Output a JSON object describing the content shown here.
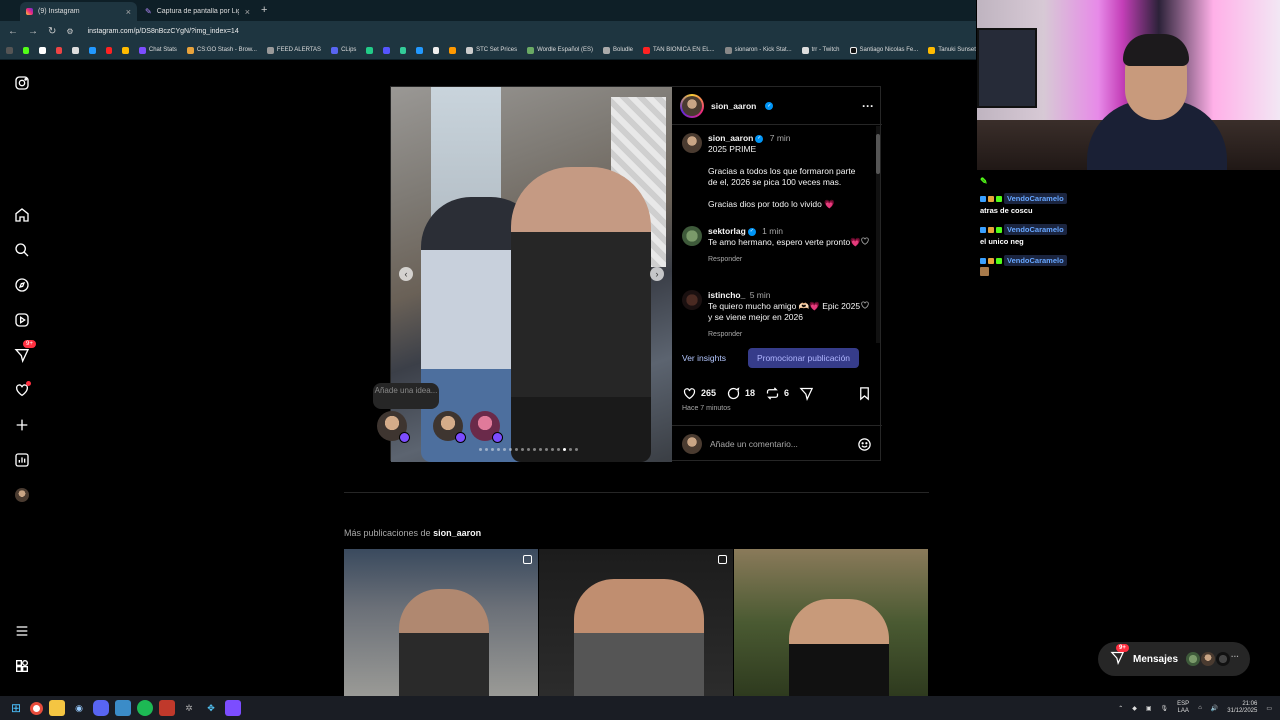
{
  "browser": {
    "tabs": [
      {
        "title": "(9) Instagram",
        "active": true
      },
      {
        "title": "Captura de pantalla por Lightsh",
        "active": false
      }
    ],
    "url": "instagram.com/p/DS8nBczCYgN/?img_index=14",
    "bookmarks": [
      "Chat Stats",
      "CS:GO Stash - Brow...",
      "FEED ALERTAS",
      "CLips",
      "STC Set Prices",
      "Wordle Español (ES)",
      "Boludle",
      "TAN BIONICA EN EL...",
      "sionaron - Kick Stat...",
      "trr - Twitch",
      "Santiago Nicolas Fe...",
      "Tanuki Sunset"
    ]
  },
  "post": {
    "author": "sion_aaron",
    "comments": [
      {
        "user": "sion_aaron",
        "time": "7 min",
        "lines": [
          "2025 PRIME",
          "Gracias a todos los que formaron parte de el, 2026 se pica 100 veces mas.",
          "Gracias dios por todo lo vivido 💗"
        ]
      },
      {
        "user": "sektorlag",
        "time": "1 min",
        "text": "Te amo hermano, espero verte pronto💗",
        "reply": "Responder"
      },
      {
        "user": "istincho_",
        "time": "5 min",
        "text": "Te quiero mucho amigo 🫶🏻💗 Epic 2025 y se viene mejor en 2026",
        "reply": "Responder"
      }
    ],
    "insights_label": "Ver insights",
    "promote_label": "Promocionar publicación",
    "likes": "265",
    "comment_count": "18",
    "reposts": "6",
    "posted_ago": "Hace 7 minutos",
    "add_comment_placeholder": "Añade un comentario...",
    "carousel_active_index": 14
  },
  "idea_bubble": "Añade una idea...",
  "more_posts": {
    "prefix": "Más publicaciones de",
    "user": "sion_aaron"
  },
  "nav": {
    "notifications_badge": "9+"
  },
  "messages": {
    "label": "Mensajes",
    "badge": "9+"
  },
  "chat": {
    "messages": [
      {
        "user": "VendoCaramelo",
        "text": "atras de coscu"
      },
      {
        "user": "VendoCaramelo",
        "text": "el unico neg"
      },
      {
        "user": "VendoCaramelo",
        "text": ""
      }
    ]
  },
  "taskbar": {
    "lang": "ESP",
    "lang2": "LAA",
    "time": "21:06",
    "date": "31/12/2025"
  }
}
